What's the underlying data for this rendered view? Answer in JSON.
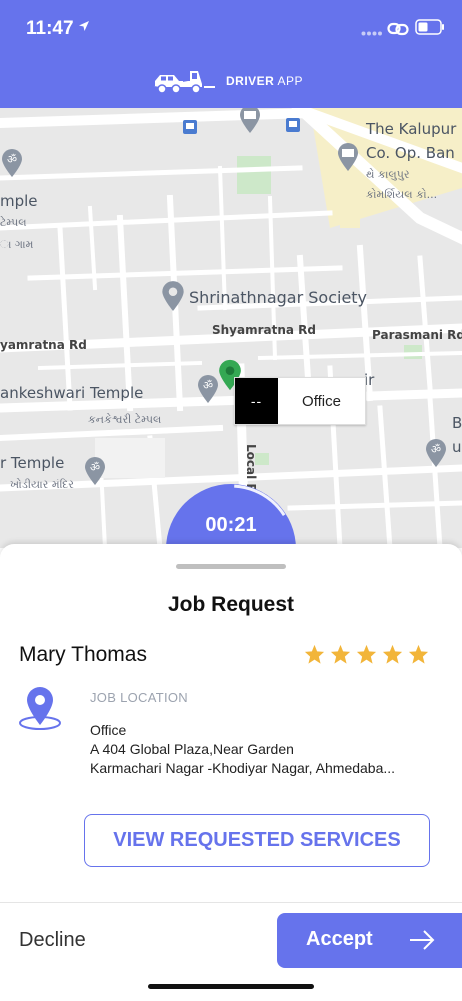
{
  "status_bar": {
    "time": "11:47"
  },
  "header": {
    "brand_bold": "DRIVER",
    "brand_rest": "APP"
  },
  "map": {
    "labels": {
      "kalupur_1": "The Kalupur",
      "kalupur_2": "Co. Op. Ban",
      "kalupur_gu": "થે કાલુપુર",
      "kalupur_gu2": "કોમર્શિયલ કો...",
      "mple": "mple",
      "mple_gu": "ટેમ્પલ",
      "gam_gu": "ા ગામ",
      "shrinath": "Shrinathnagar Society",
      "shyamratna_rd": "Shyamratna Rd",
      "yamratna_rd": "yamratna Rd",
      "parasmani_rd": "Parasmani Rd",
      "nkeshwari": "ankeshwari Temple",
      "nkeshwari_gu": "કનકેશ્વરી ટેમ્પલ",
      "r_temple": "r Temple",
      "r_temple_gu": "ખોડીયાર મંદિર",
      "local_rd": "Local R",
      "ir": "ir",
      "b": "B",
      "u": "u"
    },
    "marker_code": "--",
    "marker_label": "Office"
  },
  "timer": {
    "value": "00:21"
  },
  "job": {
    "title": "Job Request",
    "customer_name": "Mary Thomas",
    "rating": 5,
    "location_label": "JOB LOCATION",
    "address_line1": "Office",
    "address_line2": "A 404 Global Plaza,Near Garden",
    "address_line3": "Karmachari Nagar -Khodiyar Nagar, Ahmedaba...",
    "view_services_label": "VIEW REQUESTED SERVICES"
  },
  "actions": {
    "decline_label": "Decline",
    "accept_label": "Accept"
  },
  "colors": {
    "accent": "#6673ec",
    "star": "#f2b53a",
    "pin_green": "#34a853"
  }
}
